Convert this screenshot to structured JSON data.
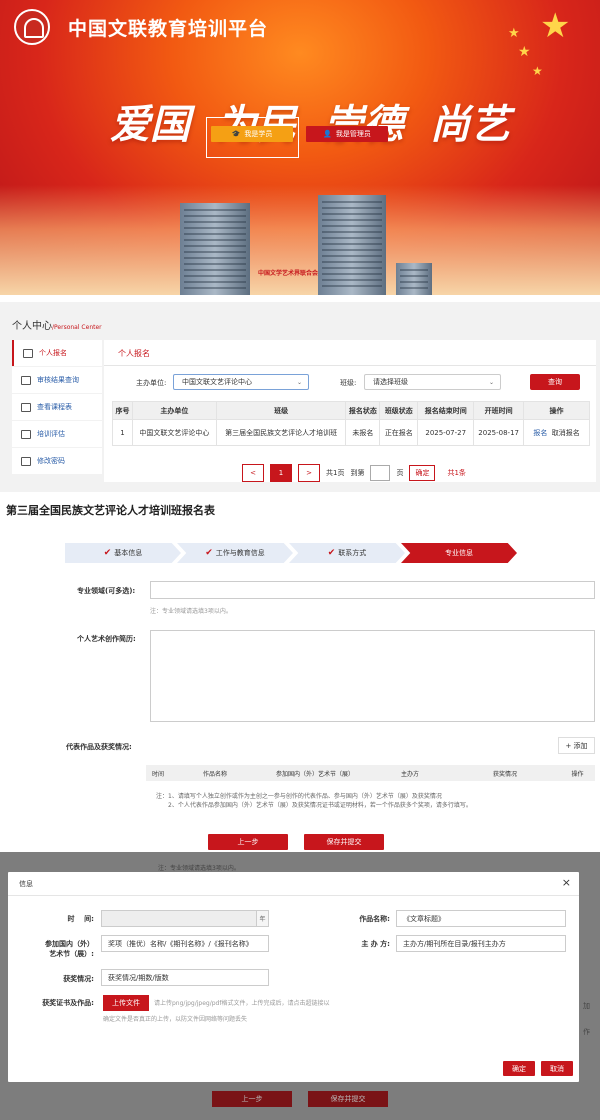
{
  "banner": {
    "site_title": "中国文联教育培训平台",
    "slogan": [
      "爱国",
      "为民",
      "崇德",
      "尚艺"
    ],
    "student_btn": "我是学员",
    "admin_btn": "我是管理员",
    "building_sign": "中国文学艺术界联合会"
  },
  "personal_center": {
    "title": "个人中心",
    "subtitle": "/Personal Center",
    "sidebar": [
      {
        "label": "个人报名",
        "icon": "form-icon"
      },
      {
        "label": "审核结果查询",
        "icon": "briefcase-icon"
      },
      {
        "label": "查看课程表",
        "icon": "schedule-icon"
      },
      {
        "label": "培训评估",
        "icon": "monitor-icon"
      },
      {
        "label": "修改密码",
        "icon": "edit-icon"
      }
    ],
    "tab": "个人报名",
    "organizer_label": "主办单位:",
    "organizer_value": "中国文联文艺评论中心",
    "class_label": "班级:",
    "class_placeholder": "请选择班级",
    "query_btn": "查询",
    "table": {
      "headers": [
        "序号",
        "主办单位",
        "班级",
        "报名状态",
        "班级状态",
        "报名结束时间",
        "开班时间",
        "操作"
      ],
      "rows": [
        {
          "no": "1",
          "org": "中国文联文艺评论中心",
          "class": "第三届全国民族文艺评论人才培训班",
          "reg_status": "未报名",
          "class_status": "正在报名",
          "end": "2025-07-27",
          "start": "2025-08-17",
          "op1": "报名",
          "op2": "取消报名"
        }
      ]
    },
    "pager": {
      "prev": "<",
      "current": "1",
      "next": ">",
      "total_pages": "共1页",
      "goto": "到第",
      "page_unit": "页",
      "ok": "确定",
      "total": "共1条"
    }
  },
  "form": {
    "title": "第三届全国民族文艺评论人才培训班报名表",
    "steps": [
      {
        "label": "基本信息",
        "done": true
      },
      {
        "label": "工作与教育信息",
        "done": true
      },
      {
        "label": "联系方式",
        "done": true
      },
      {
        "label": "专业信息",
        "done": false
      }
    ],
    "field_label": "专业领域(可多选):",
    "field_hint": "注：专业领域请选填3项以内。",
    "bio_label": "个人艺术创作简历:",
    "works_label": "代表作品及获奖情况:",
    "add_btn": "+ 添加",
    "works_headers": [
      "时间",
      "作品名称",
      "参加国内（外）艺术节（展）",
      "主办方",
      "获奖情况",
      "操作"
    ],
    "note1": "注：1、请填写个人独立创作或作为主创之一参与创作的代表作品、参与国内（外）艺术节（展）及获奖情况",
    "note2": "2、个人代表作品参加国内（外）艺术节（展）及获奖情况证书或证明材料，若一个作品获多个奖项，请多行填写。",
    "prev_btn": "上一步",
    "save_btn": "保存并提交"
  },
  "overlay": {
    "hint": "注：专业领域请选填3项以内。",
    "add_fragment": "加",
    "op_fragment": "作",
    "prev_btn": "上一步",
    "save_btn": "保存并提交"
  },
  "dialog": {
    "title": "信息",
    "close": "×",
    "time_label": "时    间:",
    "time_unit": "年",
    "work_label": "作品名称:",
    "work_value": "《文章标题》",
    "festival_label_1": "参加国内（外）",
    "festival_label_2": "艺术节（展）:",
    "festival_value": "奖项（推优）名称/《期刊名称》/《报刊名称》",
    "host_label": "主 办 方:",
    "host_value": "主办方/期刊所在目录/报刊主办方",
    "award_label": "获奖情况:",
    "award_value": "获奖情况/期数/版数",
    "cert_label": "获奖证书及作品:",
    "upload_btn": "上传文件",
    "upload_hint_1": "请上传png/jpg/jpeg/pdf格式文件，上传完成后，请点击超链接以",
    "upload_hint_2": "确定文件是否真正的上传，以防文件因网络等问题丢失",
    "ok_btn": "确定",
    "cancel_btn": "取消"
  }
}
